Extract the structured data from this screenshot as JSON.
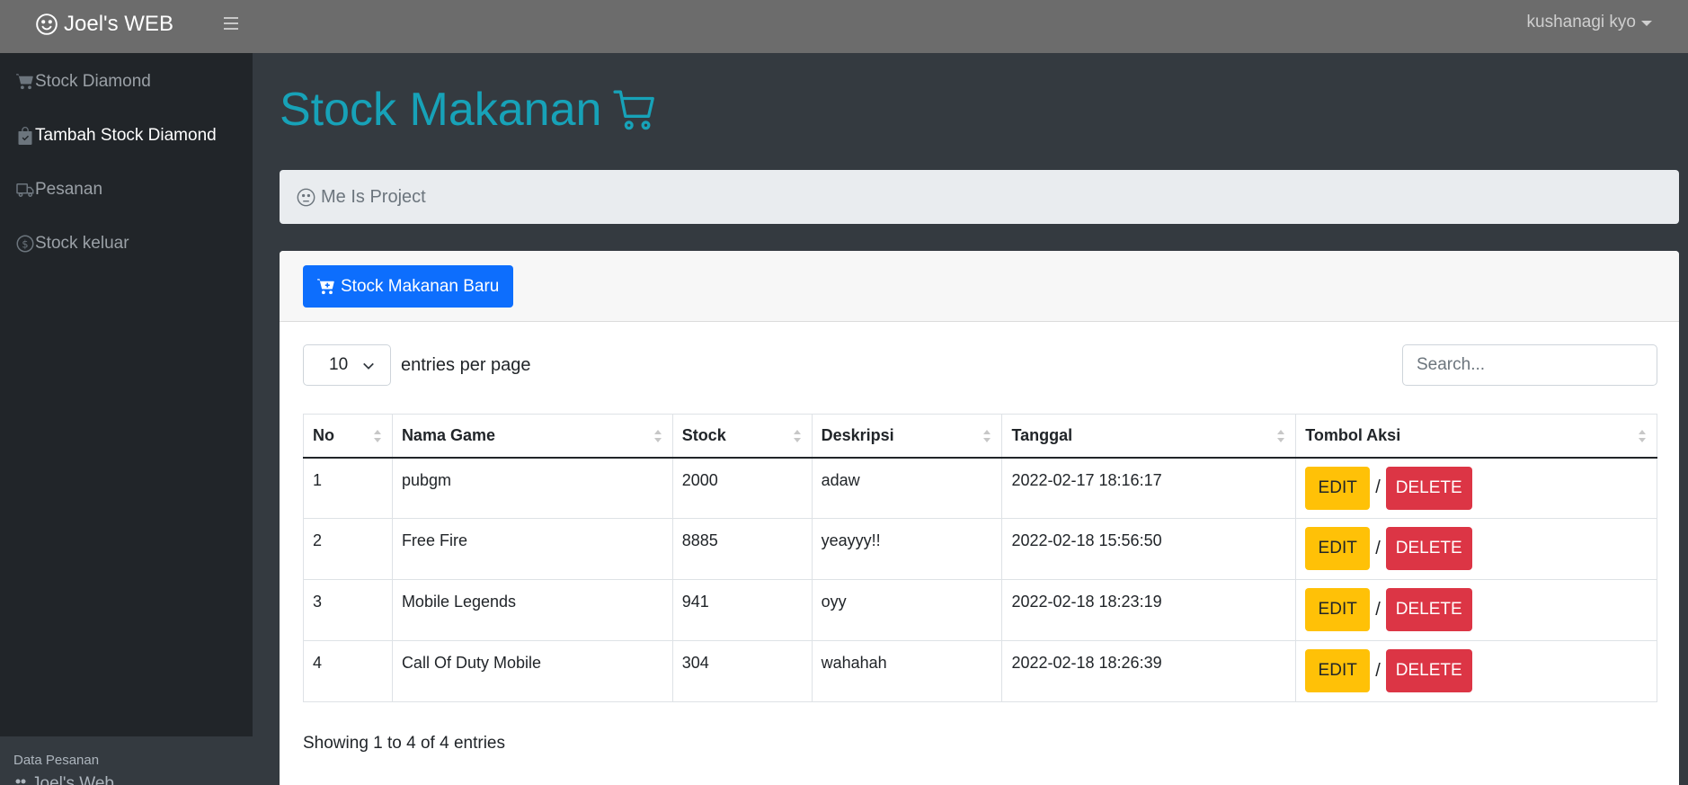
{
  "navbar": {
    "brand": "Joel's WEB",
    "user": "kushanagi kyo"
  },
  "sidebar": {
    "items": [
      {
        "label": "Stock Diamond",
        "icon": "cart-icon"
      },
      {
        "label": "Tambah Stock Diamond",
        "icon": "bag-check-icon"
      },
      {
        "label": "Pesanan",
        "icon": "truck-icon"
      },
      {
        "label": "Stock keluar",
        "icon": "coin-icon"
      }
    ],
    "footer_label": "Data Pesanan",
    "footer_brand": "Joel's Web"
  },
  "page": {
    "title": "Stock Makanan",
    "breadcrumb": "Me Is Project"
  },
  "card": {
    "new_button": "Stock Makanan Baru",
    "per_page_value": "10",
    "per_page_label": "entries per page",
    "search_placeholder": "Search...",
    "columns": [
      "No",
      "Nama Game",
      "Stock",
      "Deskripsi",
      "Tanggal",
      "Tombol Aksi"
    ],
    "rows": [
      {
        "no": "1",
        "nama": "pubgm",
        "stock": "2000",
        "deskripsi": "adaw",
        "tanggal": "2022-02-17 18:16:17"
      },
      {
        "no": "2",
        "nama": "Free Fire",
        "stock": "8885",
        "deskripsi": "yeayyy!!",
        "tanggal": "2022-02-18 15:56:50"
      },
      {
        "no": "3",
        "nama": "Mobile Legends",
        "stock": "941",
        "deskripsi": "oyy",
        "tanggal": "2022-02-18 18:23:19"
      },
      {
        "no": "4",
        "nama": "Call Of Duty Mobile",
        "stock": "304",
        "deskripsi": "wahahah",
        "tanggal": "2022-02-18 18:26:39"
      }
    ],
    "edit_label": "EDIT",
    "separator": "/",
    "delete_label": "DELETE",
    "info": "Showing 1 to 4 of 4 entries"
  },
  "colors": {
    "title": "#17a2b8",
    "primary": "#0d6efd",
    "warning": "#ffc107",
    "danger": "#dc3545"
  }
}
